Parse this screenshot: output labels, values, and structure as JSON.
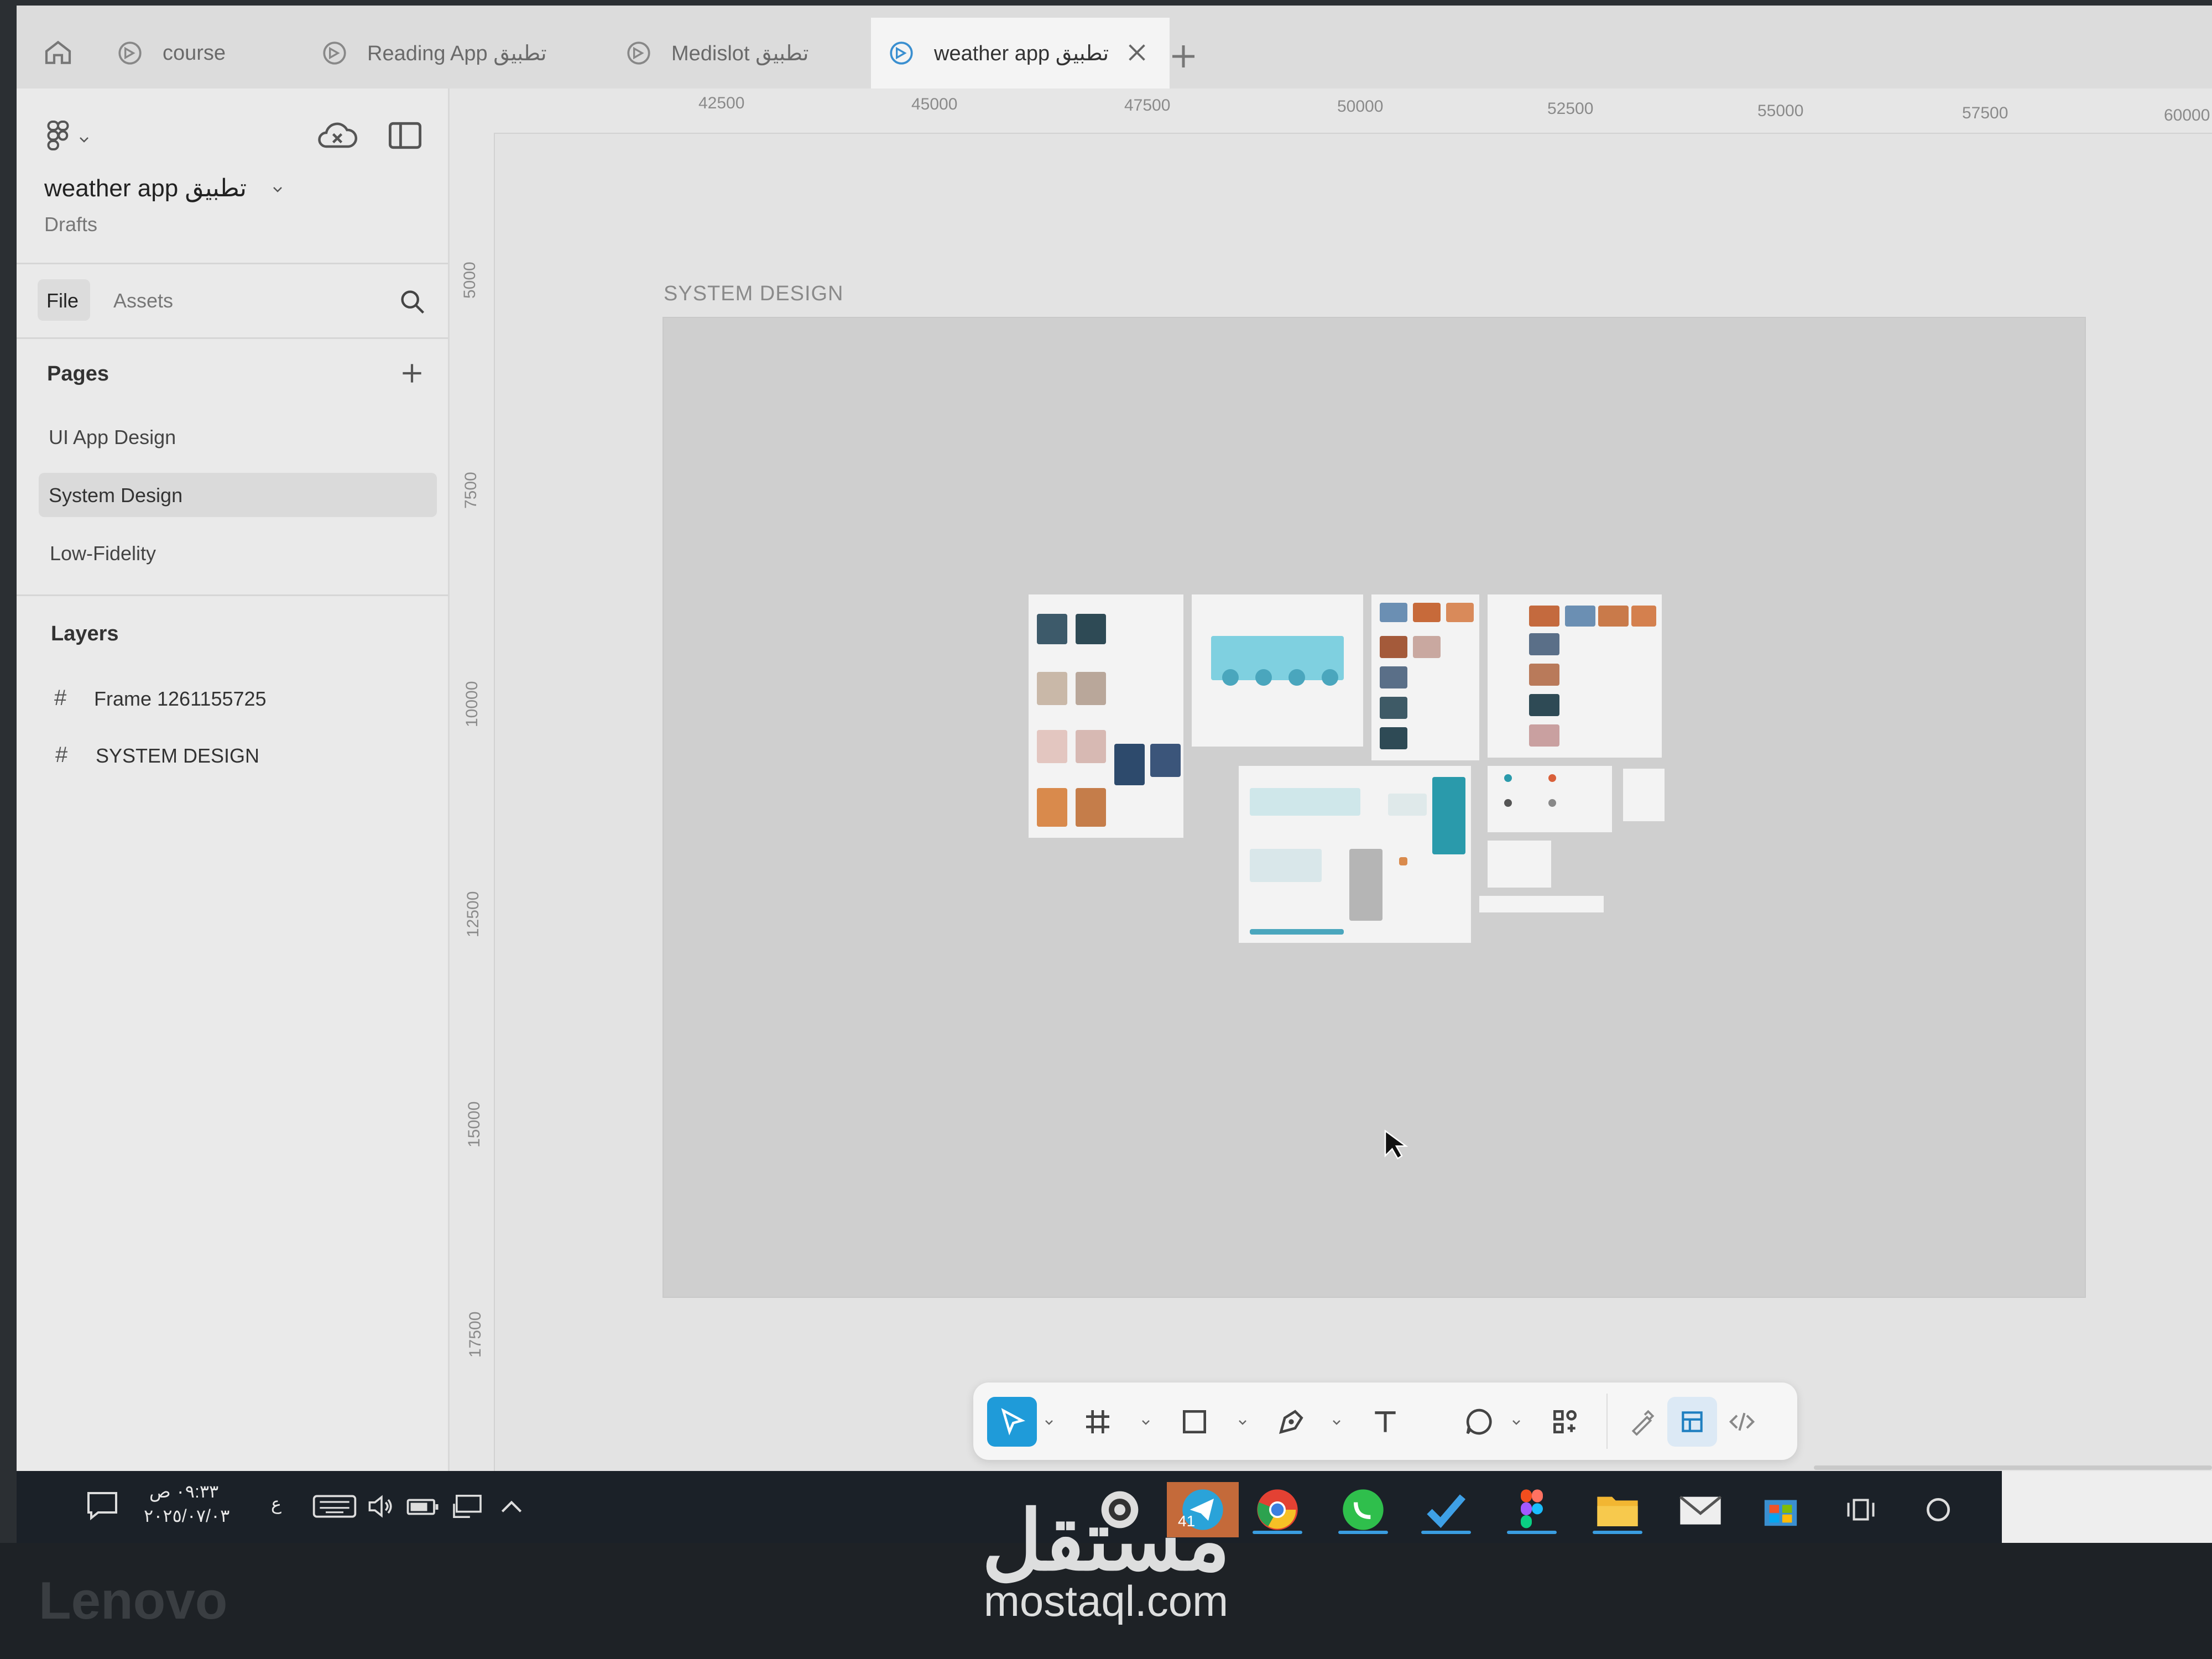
{
  "tabs": [
    {
      "label": "course"
    },
    {
      "label": "Reading App تطبيق"
    },
    {
      "label": "Medislot تطبيق"
    },
    {
      "label": "weather app تطبيق",
      "active": true
    }
  ],
  "sidebar": {
    "file_title": "weather app تطبيق",
    "file_location": "Drafts",
    "tab_file": "File",
    "tab_assets": "Assets",
    "pages_heading": "Pages",
    "pages": [
      "UI App Design",
      "System Design",
      "Low-Fidelity"
    ],
    "selected_page": "System Design",
    "layers_heading": "Layers",
    "layers": [
      "Frame 1261155725",
      "SYSTEM DESIGN"
    ]
  },
  "ruler": {
    "top": [
      "42500",
      "45000",
      "47500",
      "50000",
      "52500",
      "55000",
      "57500",
      "60000"
    ],
    "left": [
      "5000",
      "7500",
      "10000",
      "12500",
      "15000",
      "17500"
    ]
  },
  "canvas": {
    "frame_label": "SYSTEM  DESIGN"
  },
  "toolbar": {
    "tools": [
      "move-tool",
      "frame-tool",
      "rectangle-tool",
      "pen-tool",
      "text-tool",
      "comment-tool",
      "actions-tool",
      "draw-mode",
      "design-mode",
      "dev-mode"
    ],
    "active": "move-tool"
  },
  "taskbar": {
    "time": "٠٩:٣٣ ص",
    "date": "٢٠٢٥/٠٧/٠٣",
    "lang": "ع",
    "badge": "41"
  },
  "device": {
    "brand": "Lenovo"
  },
  "watermark": {
    "logo_text": "مستقل",
    "site": "mostaql.com"
  },
  "colors": {
    "accent": "#1f9bd9",
    "canvas": "#e3e3e3",
    "frame": "#cfcfcf"
  }
}
